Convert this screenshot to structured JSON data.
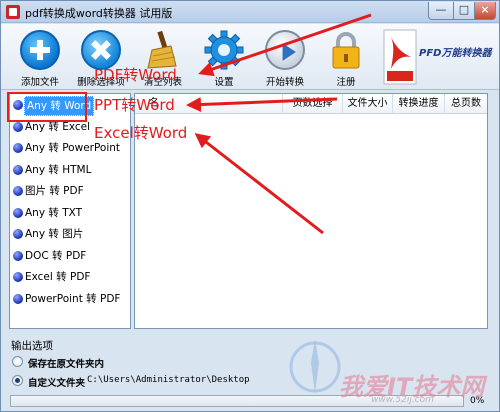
{
  "window": {
    "title": "pdf转换成word转换器 试用版",
    "min": "—",
    "max": "□",
    "close": "×"
  },
  "toolbar": {
    "items": [
      {
        "label": "添加文件",
        "icon": "plus-circle-icon"
      },
      {
        "label": "删除选择项",
        "icon": "x-circle-icon"
      },
      {
        "label": "清空列表",
        "icon": "broom-icon"
      },
      {
        "label": "设置",
        "icon": "gear-icon"
      },
      {
        "label": "开始转换",
        "icon": "play-icon"
      },
      {
        "label": "注册",
        "icon": "lock-icon"
      }
    ],
    "brand": "PFD万能转换器",
    "brand_badge": "PDF"
  },
  "conversions": {
    "items": [
      "Any 转 Word",
      "Any 转 Excel",
      "Any 转 PowerPoint",
      "Any 转 HTML",
      "图片 转 PDF",
      "Any 转 TXT",
      "Any 转 图片",
      "DOC 转 PDF",
      "Excel 转 PDF",
      "PowerPoint 转 PDF"
    ],
    "selected_index": 0
  },
  "file_list": {
    "columns": [
      "页数选择",
      "文件大小",
      "转换进度",
      "总页数"
    ],
    "first_column_partial": "名"
  },
  "output": {
    "section_label": "输出选项",
    "option_same_folder": "保存在原文件夹内",
    "option_custom_folder": "自定义文件夹",
    "selected": "custom",
    "path": "C:\\Users\\Administrator\\Desktop",
    "progress_percent": 0,
    "progress_label": "0%"
  },
  "annotations": {
    "pdf_word": "PDF转Word",
    "ppt_word": "PPT转Word",
    "excel_word": "Excel转Word",
    "color": "#e21c1c"
  },
  "watermark": {
    "text": "我爱IT技术网",
    "sub": "www.52ij.com"
  }
}
